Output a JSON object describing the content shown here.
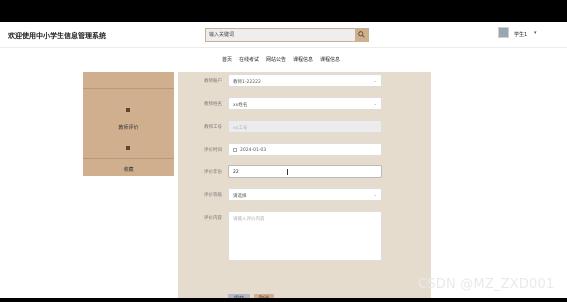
{
  "header": {
    "title": "欢迎使用中小学生信息管理系统",
    "search_placeholder": "输入关键词",
    "username": "学生1",
    "user_caret": "▾"
  },
  "nav": {
    "items": [
      "首页",
      "在线考试",
      "网站公告",
      "课程信息",
      "课程信息"
    ]
  },
  "sidebar": {
    "items": [
      "教师评价",
      "收藏"
    ]
  },
  "form": {
    "fields": [
      {
        "label": "教师账户",
        "value": "教师1-22222",
        "type": "select"
      },
      {
        "label": "教师姓名",
        "value": "xx姓名",
        "type": "select"
      },
      {
        "label": "教师工号",
        "value": "xx工号",
        "type": "disabled"
      },
      {
        "label": "评价时间",
        "value": "2024-01-03",
        "type": "date"
      },
      {
        "label": "评价年份",
        "value": "22",
        "type": "text"
      },
      {
        "label": "评价等级",
        "value": "请选择",
        "type": "select"
      },
      {
        "label": "评价内容",
        "value": "请输入评价内容",
        "type": "textarea"
      }
    ],
    "submit_label": "提交",
    "cancel_label": "取消"
  },
  "watermark": "CSDN @MZ_ZXD001",
  "colors": {
    "accent": "#cfaf8e",
    "panel": "#e6dccd",
    "submit": "#b1b9c6"
  }
}
